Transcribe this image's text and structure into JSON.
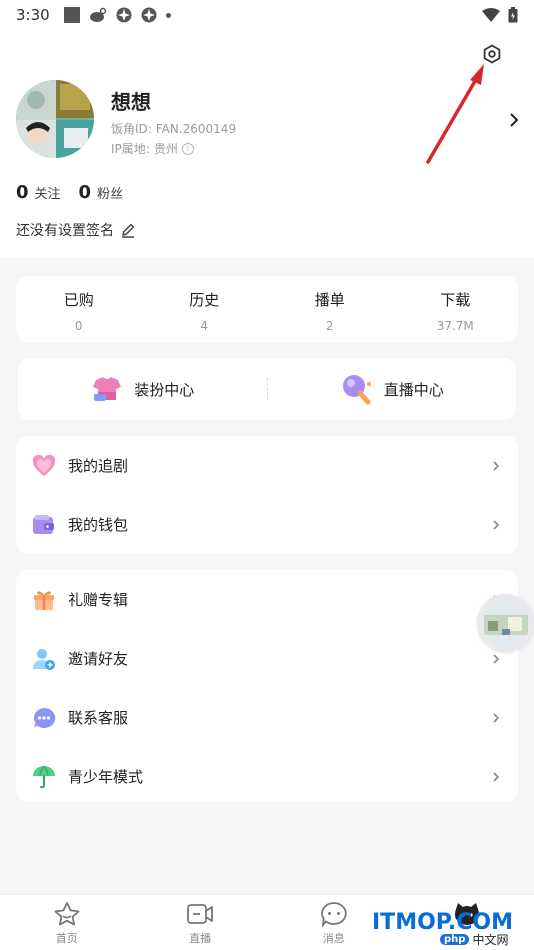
{
  "status_bar": {
    "time": "3:30",
    "icons": [
      "stop-square-icon",
      "weibo-icon",
      "pinwheel-icon",
      "pinwheel-icon",
      "dot-icon",
      "wifi-icon",
      "battery-icon"
    ]
  },
  "profile": {
    "nickname": "想想",
    "id_label": "饭角ID:",
    "id_value": "FAN.2600149",
    "ip_label": "IP属地:",
    "ip_value": "贵州",
    "following_count": "0",
    "following_label": "关注",
    "fans_count": "0",
    "fans_label": "粉丝",
    "signature": "还没有设置签名"
  },
  "stats": [
    {
      "label": "已购",
      "value": "0"
    },
    {
      "label": "历史",
      "value": "4"
    },
    {
      "label": "播单",
      "value": "2"
    },
    {
      "label": "下载",
      "value": "37.7M"
    }
  ],
  "centers": [
    {
      "label": "装扮中心",
      "icon": "dress-up-icon"
    },
    {
      "label": "直播中心",
      "icon": "live-mic-icon"
    }
  ],
  "menu_group_1": [
    {
      "label": "我的追剧",
      "icon": "heart-icon",
      "color": "#f06ba8"
    },
    {
      "label": "我的钱包",
      "icon": "wallet-icon",
      "color": "#8f6ef0"
    }
  ],
  "menu_group_2": [
    {
      "label": "礼赠专辑",
      "icon": "gift-icon",
      "color": "#f59a5a"
    },
    {
      "label": "邀请好友",
      "icon": "invite-user-icon",
      "color": "#5ab8f5"
    },
    {
      "label": "联系客服",
      "icon": "chat-service-icon",
      "color": "#7b83f0"
    },
    {
      "label": "青少年模式",
      "icon": "umbrella-icon",
      "color": "#3fc27a"
    }
  ],
  "tabs": [
    {
      "label": "首页",
      "icon": "home-star-icon"
    },
    {
      "label": "直播",
      "icon": "live-video-icon"
    },
    {
      "label": "消息",
      "icon": "message-icon"
    },
    {
      "label": "",
      "icon": "profile-cat-icon"
    }
  ],
  "watermark": {
    "brand": "ITMOP",
    "suffix": ".COM",
    "badge": "php",
    "site": "中文网"
  },
  "colors": {
    "accent_red_arrow": "#d9262c",
    "watermark_blue": "#0a6dd6"
  }
}
